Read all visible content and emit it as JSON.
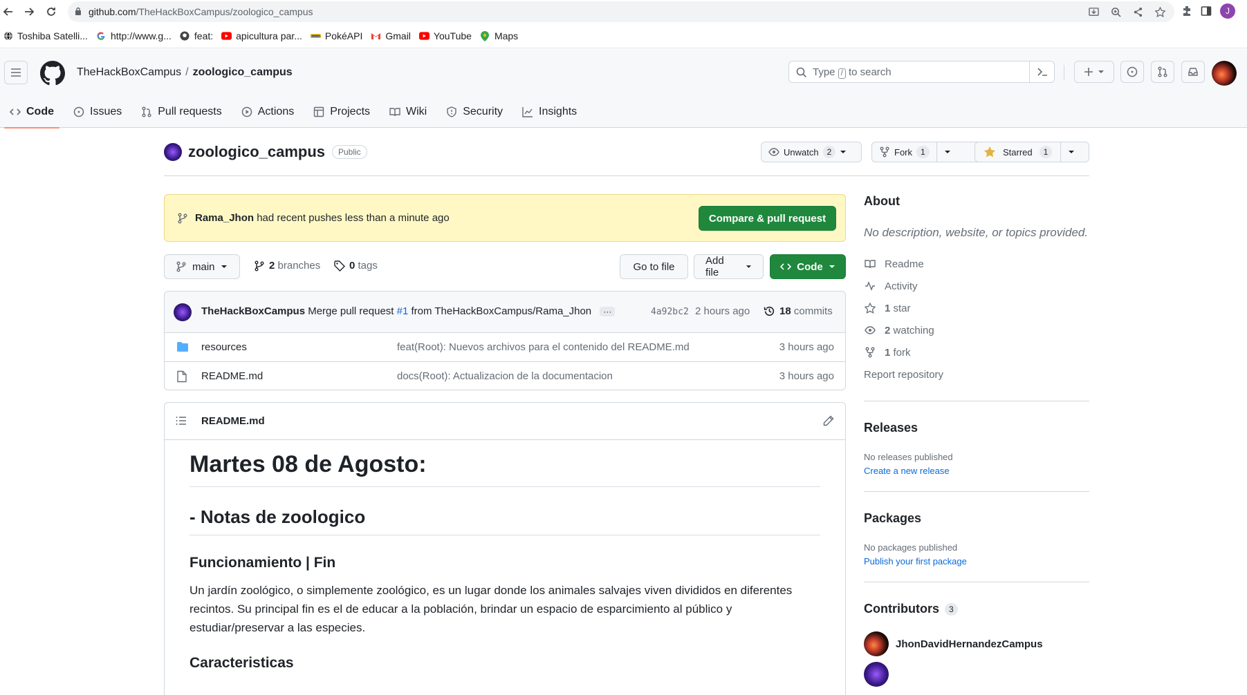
{
  "browser": {
    "url_host": "github.com",
    "url_path": "/TheHackBoxCampus/zoologico_campus",
    "profile_initial": "J",
    "bookmarks": [
      {
        "label": "Toshiba Satelli...",
        "icon": "globe-icon"
      },
      {
        "label": "http://www.g...",
        "icon": "google-icon"
      },
      {
        "label": "feat:",
        "icon": "github-icon"
      },
      {
        "label": "apicultura par...",
        "icon": "youtube-icon"
      },
      {
        "label": "PokéAPI",
        "icon": "pokeapi-icon"
      },
      {
        "label": "Gmail",
        "icon": "gmail-icon"
      },
      {
        "label": "YouTube",
        "icon": "youtube-icon"
      },
      {
        "label": "Maps",
        "icon": "maps-icon"
      }
    ]
  },
  "header": {
    "owner": "TheHackBoxCampus",
    "separator": "/",
    "repo": "zoologico_campus",
    "search_prefix": "Type",
    "search_key": "/",
    "search_suffix": "to search"
  },
  "tabs": [
    {
      "label": "Code",
      "icon": "code-icon"
    },
    {
      "label": "Issues",
      "icon": "issue-icon"
    },
    {
      "label": "Pull requests",
      "icon": "pull-request-icon"
    },
    {
      "label": "Actions",
      "icon": "play-icon"
    },
    {
      "label": "Projects",
      "icon": "table-icon"
    },
    {
      "label": "Wiki",
      "icon": "book-icon"
    },
    {
      "label": "Security",
      "icon": "shield-icon"
    },
    {
      "label": "Insights",
      "icon": "graph-icon"
    }
  ],
  "repo": {
    "name": "zoologico_campus",
    "visibility": "Public",
    "unwatch_label": "Unwatch",
    "watch_count": "2",
    "fork_label": "Fork",
    "fork_count": "1",
    "starred_label": "Starred",
    "star_count": "1"
  },
  "banner": {
    "user": "Rama_Jhon",
    "text": "had recent pushes less than a minute ago",
    "button": "Compare & pull request"
  },
  "controls": {
    "branch": "main",
    "branches_count": "2",
    "branches_label": "branches",
    "tags_count": "0",
    "tags_label": "tags",
    "go_to_file": "Go to file",
    "add_file": "Add file",
    "code_button": "Code"
  },
  "last_commit": {
    "author": "TheHackBoxCampus",
    "message_prefix": "Merge pull request",
    "pr": "#1",
    "message_suffix": "from TheHackBoxCampus/Rama_Jhon",
    "ellipsis": "···",
    "sha": "4a92bc2",
    "time": "2 hours ago",
    "commits_count": "18",
    "commits_label": "commits"
  },
  "files": [
    {
      "name": "resources",
      "type": "folder",
      "message": "feat(Root): Nuevos archivos para el contenido del README.md",
      "time": "3 hours ago"
    },
    {
      "name": "README.md",
      "type": "file",
      "message": "docs(Root): Actualizacion de la documentacion",
      "time": "3 hours ago"
    }
  ],
  "readme": {
    "title": "README.md",
    "h1": "Martes 08 de Agosto:",
    "h2": "- Notas de zoologico",
    "h3a": "Funcionamiento | Fin",
    "p1": "Un jardín zoológico, o simplemente zoológico, es un lugar donde los animales salvajes viven divididos en diferentes recintos. Su principal fin es el de educar a la población, brindar un espacio de esparcimiento al público y estudiar/preservar a las especies.",
    "h3b": "Caracteristicas"
  },
  "sidebar": {
    "about_title": "About",
    "about_desc": "No description, website, or topics provided.",
    "readme": "Readme",
    "activity": "Activity",
    "stars_count": "1",
    "stars_label": "star",
    "watching_count": "2",
    "watching_label": "watching",
    "forks_count": "1",
    "forks_label": "fork",
    "report": "Report repository",
    "releases_title": "Releases",
    "no_releases": "No releases published",
    "create_release": "Create a new release",
    "packages_title": "Packages",
    "no_packages": "No packages published",
    "publish_package": "Publish your first package",
    "contributors_title": "Contributors",
    "contributors_count": "3",
    "contributor_1": "JhonDavidHernandezCampus"
  },
  "colors": {
    "accent_green": "#1f883d",
    "link_blue": "#0969da",
    "tab_underline": "#fd8c73",
    "banner_yellow": "#fff8c5"
  }
}
